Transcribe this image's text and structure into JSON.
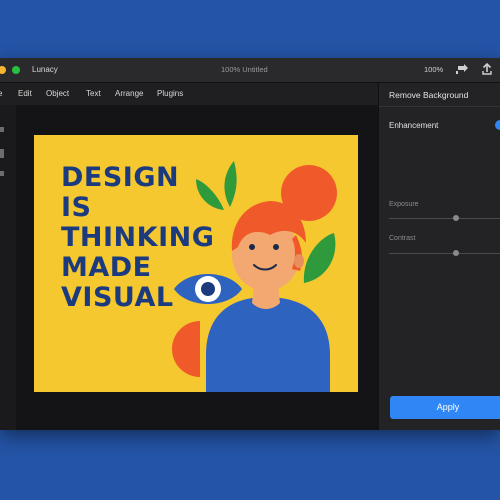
{
  "app": {
    "name": "Lunacy",
    "document_title": "100%  Untitled",
    "zoom_right": "100%"
  },
  "menu": {
    "items": [
      "e",
      "Edit",
      "Object",
      "Text",
      "Arrange",
      "Plugins"
    ]
  },
  "artboard": {
    "lines": [
      "DESIGN",
      "IS",
      "THINKING",
      "MADE",
      "VISUAL"
    ]
  },
  "right_panel": {
    "title": "Remove Background",
    "section": "Enhancement",
    "sliders": [
      {
        "label": "Exposure",
        "value": 0.6
      },
      {
        "label": "Contrast",
        "value": 0.6
      }
    ],
    "apply_label": "Apply"
  },
  "colors": {
    "accent": "#2f86f4",
    "artboard_bg": "#f6c830",
    "headline": "#1c3b7e",
    "page_bg": "#2454a6"
  },
  "icons": {
    "export": "export-icon",
    "share": "share-icon"
  }
}
